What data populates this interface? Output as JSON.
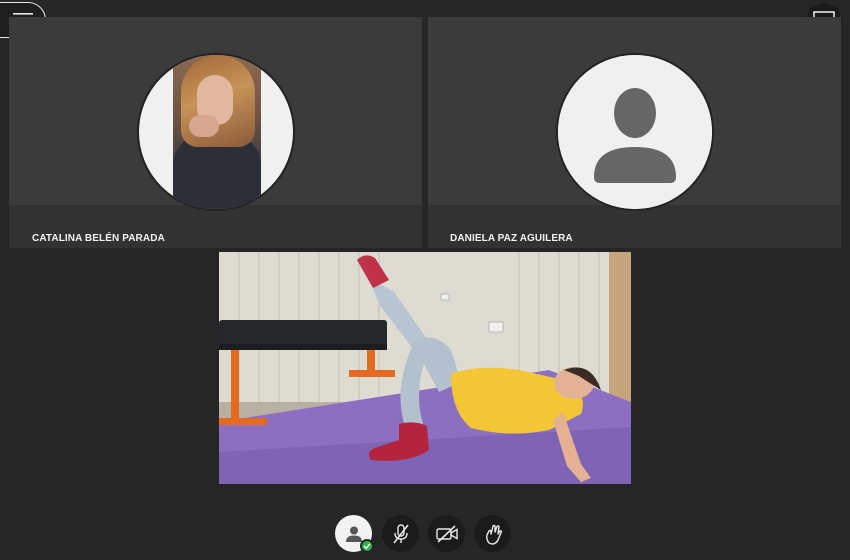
{
  "app": {
    "menu_icon": "hamburger-menu-icon",
    "recording_icon": "recording-indicator-icon",
    "layout_icon": "layout-switch-icon"
  },
  "participants": [
    {
      "name": "CATALINA BELÉN PARADA",
      "avatar": "profile-photo"
    },
    {
      "name": "DANIELA PAZ AGUILERA",
      "avatar": "default-user-icon"
    }
  ],
  "main_video": {
    "content": "live-camera-feed"
  },
  "controls": [
    {
      "name": "status",
      "icon": "user-status-icon"
    },
    {
      "name": "microphone",
      "icon": "microphone-muted-icon"
    },
    {
      "name": "camera",
      "icon": "camera-off-icon"
    },
    {
      "name": "raise-hand",
      "icon": "raise-hand-icon"
    }
  ],
  "colors": {
    "background": "#262626",
    "tile": "#3b3b3b",
    "tile_footer": "#323232",
    "status_ok": "#2fb24c",
    "recording": "#e5323c"
  }
}
